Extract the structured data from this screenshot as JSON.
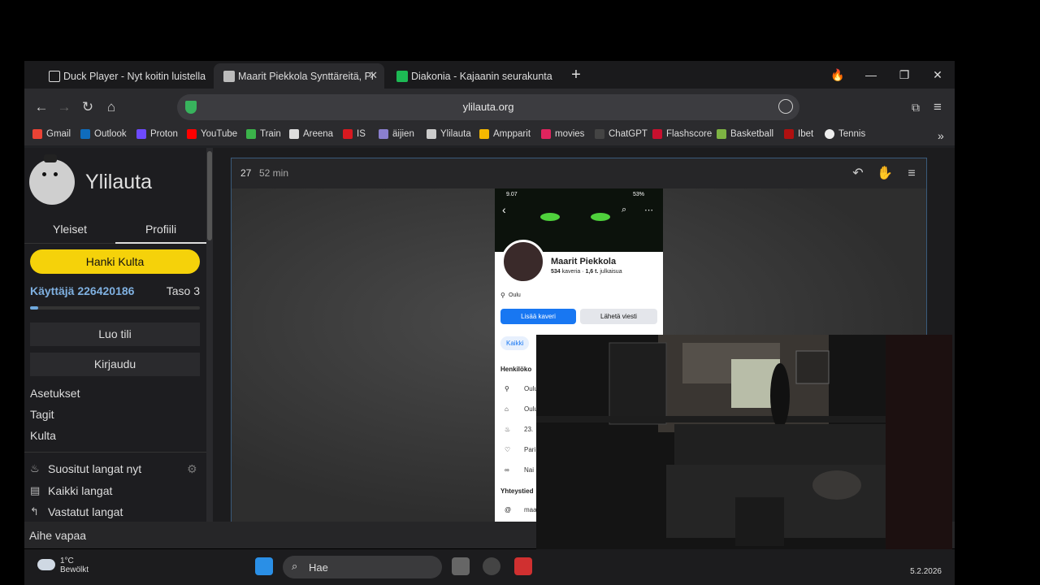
{
  "tabs": [
    {
      "label": "Duck Player - Nyt koitin luistella",
      "icon": "duck-player-icon"
    },
    {
      "label": "Maarit Piekkola Synttäreitä, Pi",
      "icon": "ylilauta-favicon",
      "active": true
    },
    {
      "label": "Diakonia - Kajaanin seurakunta",
      "icon": "diakonia-favicon"
    }
  ],
  "toolbar": {
    "url": "ylilauta.org"
  },
  "bookmarks": [
    {
      "label": "Gmail",
      "color": "#ea4335"
    },
    {
      "label": "Outlook",
      "color": "#0f6cbd"
    },
    {
      "label": "Proton",
      "color": "#6d4aff"
    },
    {
      "label": "YouTube",
      "color": "#ff0000"
    },
    {
      "label": "Train",
      "color": "#3bb34a"
    },
    {
      "label": "Areena",
      "color": "#dddddd"
    },
    {
      "label": "IS",
      "color": "#d71920"
    },
    {
      "label": "äijien",
      "color": "#8a7fcf"
    },
    {
      "label": "Ylilauta",
      "color": "#cccccc"
    },
    {
      "label": "Ampparit",
      "color": "#f5b800"
    },
    {
      "label": "movies",
      "color": "#e0245e"
    },
    {
      "label": "ChatGPT",
      "color": "#444444"
    },
    {
      "label": "Flashscore",
      "color": "#c8102e"
    },
    {
      "label": "Basketball",
      "color": "#7db343"
    },
    {
      "label": "Ibet",
      "color": "#b01010"
    },
    {
      "label": "Tennis",
      "color": "#eeeeee"
    }
  ],
  "sidebar": {
    "brand": "Ylilauta",
    "tabs": [
      "Yleiset",
      "Profiili"
    ],
    "gold_button": "Hanki Kulta",
    "user": "Käyttäjä 226420186",
    "level": "Taso 3",
    "level_progress": 0.05,
    "create_account": "Luo tili",
    "login": "Kirjaudu",
    "links": [
      "Asetukset",
      "Tagit",
      "Kulta"
    ],
    "items": [
      "Suositut langat nyt",
      "Kaikki langat",
      "Vastatut langat"
    ]
  },
  "thread": {
    "post_number": "27",
    "post_time": "52 min"
  },
  "phone": {
    "status_time": "9.07",
    "battery": "53%",
    "name": "Maarit Piekkola",
    "friends": "534",
    "friends_label": "kaveria",
    "posts": "1,6 t.",
    "posts_label": "julkaisua",
    "city": "Oulu",
    "add_friend": "Lisää kaveri",
    "send_message": "Lähetä viesti",
    "all_tab": "Kaikki",
    "section_personal": "Henkilöko",
    "rows": [
      "Oulu",
      "Oulu",
      "23.",
      "Pari",
      "Nai"
    ],
    "section_contact": "Yhteystied",
    "contact_row": "maa"
  },
  "statusbar": {
    "topic": "Aihe vapaa"
  },
  "taskbar": {
    "temperature": "1°C",
    "condition": "Bewölkt",
    "search_placeholder": "Hae",
    "date": "5.2.2026"
  }
}
